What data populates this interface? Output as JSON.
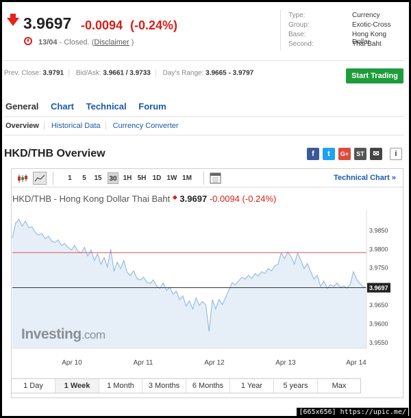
{
  "quote": {
    "price": "3.9697",
    "change": "-0.0094",
    "change_pct": "(-0.24%)",
    "date": "13/04",
    "status": "- Closed.",
    "paren_open": "(",
    "disclaimer": "Disclaimer",
    "paren_close": ")"
  },
  "info": [
    {
      "k": "Type:",
      "v": "Currency"
    },
    {
      "k": "Group:",
      "v": "Exotic-Cross"
    },
    {
      "k": "Base:",
      "v": "Hong Kong Dollar"
    },
    {
      "k": "Second:",
      "v": "Thai Baht"
    }
  ],
  "stats": {
    "prev_close_label": "Prev. Close:",
    "prev_close": "3.9791",
    "bidask_label": "Bid/Ask:",
    "bidask": "3.9661 / 3.9733",
    "range_label": "Day's Range:",
    "range": "3.9665 - 3.9797"
  },
  "start_trading": "Start Trading",
  "tabs": [
    "General",
    "Chart",
    "Technical",
    "Forum"
  ],
  "subtabs": [
    "Overview",
    "Historical Data",
    "Currency Converter"
  ],
  "overview_title": "HKD/THB Overview",
  "social": [
    "f",
    "t",
    "G+",
    "ST",
    "✉",
    "i"
  ],
  "toolbar": {
    "intervals": [
      "1",
      "5",
      "15",
      "30",
      "1H",
      "5H",
      "1D",
      "1W",
      "1M"
    ],
    "selected": "30",
    "technical_chart": "Technical Chart »"
  },
  "chart_title": {
    "name": "HKD/THB - Hong Kong Dollar Thai Baht",
    "price": "3.9697",
    "change": "-0.0094",
    "change_pct": "(-0.24%)"
  },
  "watermark": {
    "main": "Investing",
    "suffix": ".com"
  },
  "ranges": [
    "1 Day",
    "1 Week",
    "1 Month",
    "3 Months",
    "6 Months",
    "1 Year",
    "5 years",
    "Max"
  ],
  "range_selected": "1 Week",
  "footer": "[665x656] https://upic.me/",
  "colors": {
    "up_red": "#d91e18",
    "link": "#1a5aa7",
    "green": "#1e9c3c",
    "line": "#8fb8e0",
    "fill": "#e6eff8"
  },
  "chart_data": {
    "type": "area",
    "x_ticks": [
      "Apr 10",
      "Apr 11",
      "Apr 12",
      "Apr 13",
      "Apr 14"
    ],
    "y_ticks": [
      "3.9850",
      "3.9800",
      "3.9750",
      "3.9700",
      "3.9650",
      "3.9600",
      "3.9550"
    ],
    "ylim": [
      3.9535,
      3.9905
    ],
    "prev_close": 3.9791,
    "last": 3.9697,
    "last_label": "3.9697",
    "grid": false,
    "values": [
      3.983,
      3.987,
      3.988,
      3.9862,
      3.9875,
      3.9858,
      3.986,
      3.9845,
      3.9838,
      3.9842,
      3.9828,
      3.9835,
      3.9822,
      3.9818,
      3.9825,
      3.981,
      3.9815,
      3.9805,
      3.9798,
      3.981,
      3.9795,
      3.979,
      3.9805,
      3.9782,
      3.9798,
      3.977,
      3.9788,
      3.976,
      3.9778,
      3.9752,
      3.98,
      3.9742,
      3.9765,
      3.9748,
      3.977,
      3.9738,
      3.973,
      3.9742,
      3.9722,
      3.9718,
      3.9725,
      3.9712,
      3.9708,
      3.9718,
      3.9702,
      3.9695,
      3.971,
      3.969,
      3.9698,
      3.968,
      3.9688,
      3.9665,
      3.9675,
      3.9648,
      3.9662,
      3.964,
      3.967,
      3.965,
      3.966,
      3.9652,
      3.958,
      3.9665,
      3.964,
      3.9665,
      3.9652,
      3.967,
      3.969,
      3.971,
      3.9705,
      3.9715,
      3.9725,
      3.972,
      3.973,
      3.9722,
      3.9735,
      3.9728,
      3.974,
      3.9735,
      3.9748,
      3.9742,
      3.9755,
      3.976,
      3.979,
      3.9775,
      3.9792,
      3.978,
      3.976,
      3.979,
      3.977,
      3.9748,
      3.9762,
      3.974,
      3.972,
      3.973,
      3.97,
      3.9715,
      3.9695,
      3.9705,
      3.97,
      3.971,
      3.9698,
      3.9702,
      3.9696,
      3.9705,
      3.974,
      3.972,
      3.9708,
      3.97,
      3.9697
    ]
  }
}
